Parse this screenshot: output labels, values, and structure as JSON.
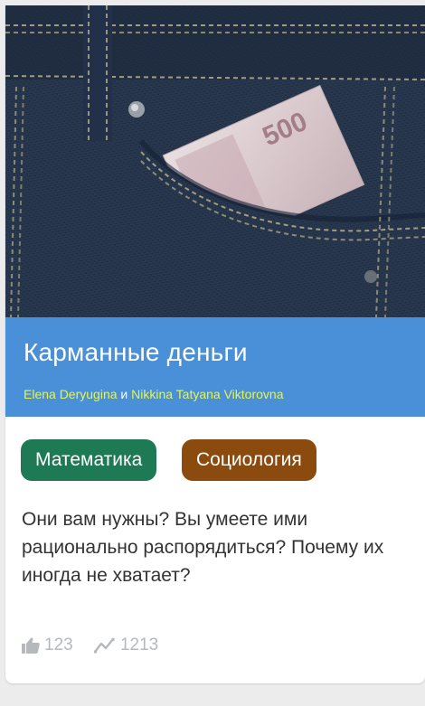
{
  "card": {
    "image": {
      "icon": "jeans-pocket-banknote-photo",
      "banknote_text": "500"
    },
    "title": "Карманные деньги",
    "authors": [
      {
        "name": "Elena Deryugina"
      },
      {
        "name": "Nikkina Tatyana Viktorovna"
      }
    ],
    "authors_conjunction": "и",
    "tags": [
      {
        "label": "Математика",
        "color": "#1e7a55"
      },
      {
        "label": "Социология",
        "color": "#8b4a0e"
      }
    ],
    "description": "Они вам нужны? Вы умеете ими рационально распорядиться? Почему их иногда не хватает?",
    "stats": {
      "likes": {
        "icon": "thumbs-up-icon",
        "value": "123"
      },
      "views": {
        "icon": "trend-line-icon",
        "value": "1213"
      }
    }
  },
  "colors": {
    "title_band": "#4a90d9",
    "author_link": "#e7f54b",
    "background": "#ececec"
  }
}
